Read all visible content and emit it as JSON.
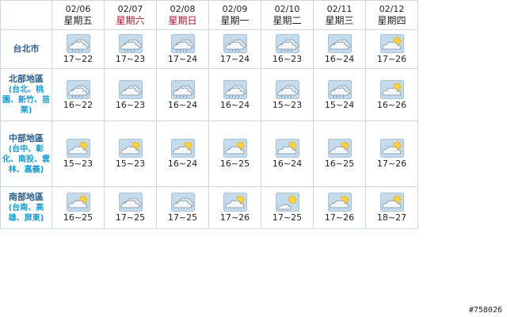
{
  "days": [
    {
      "date": "02/06",
      "weekday": "星期五",
      "weekend": false
    },
    {
      "date": "02/07",
      "weekday": "星期六",
      "weekend": true
    },
    {
      "date": "02/08",
      "weekday": "星期日",
      "weekend": true
    },
    {
      "date": "02/09",
      "weekday": "星期一",
      "weekend": false
    },
    {
      "date": "02/10",
      "weekday": "星期二",
      "weekend": false
    },
    {
      "date": "02/11",
      "weekday": "星期三",
      "weekend": false
    },
    {
      "date": "02/12",
      "weekday": "星期四",
      "weekend": false
    }
  ],
  "regions": [
    {
      "name": "台北市",
      "sub": "",
      "cells": [
        {
          "icon": "rain-icon",
          "temp": "17~22"
        },
        {
          "icon": "rain-icon",
          "temp": "17~23"
        },
        {
          "icon": "rain-icon",
          "temp": "17~24"
        },
        {
          "icon": "rain-icon",
          "temp": "17~24"
        },
        {
          "icon": "rain-icon",
          "temp": "16~23"
        },
        {
          "icon": "cloudy-icon",
          "temp": "16~24"
        },
        {
          "icon": "partly-cloudy-icon",
          "temp": "17~26"
        }
      ]
    },
    {
      "name": "北部地區",
      "sub": "(台北、桃園、新竹、苗栗)",
      "cells": [
        {
          "icon": "rain-icon",
          "temp": "16~22"
        },
        {
          "icon": "cloudy-icon",
          "temp": "16~23"
        },
        {
          "icon": "rain-icon",
          "temp": "16~24"
        },
        {
          "icon": "rain-icon",
          "temp": "16~24"
        },
        {
          "icon": "rain-icon",
          "temp": "15~23"
        },
        {
          "icon": "rain-icon",
          "temp": "15~24"
        },
        {
          "icon": "partly-cloudy-icon",
          "temp": "16~26"
        }
      ]
    },
    {
      "name": "中部地區",
      "sub": "(台中、彰化、南投、雲林、嘉義)",
      "cells": [
        {
          "icon": "partly-cloudy-icon",
          "temp": "15~23"
        },
        {
          "icon": "partly-cloudy-icon",
          "temp": "15~23"
        },
        {
          "icon": "partly-cloudy-icon",
          "temp": "16~24"
        },
        {
          "icon": "partly-cloudy-icon",
          "temp": "16~25"
        },
        {
          "icon": "partly-cloudy-icon",
          "temp": "16~24"
        },
        {
          "icon": "partly-cloudy-icon",
          "temp": "16~25"
        },
        {
          "icon": "partly-cloudy-icon",
          "temp": "17~26"
        }
      ]
    },
    {
      "name": "南部地區",
      "sub": "(台南、高雄、屏東)",
      "cells": [
        {
          "icon": "partly-cloudy-icon",
          "temp": "16~25"
        },
        {
          "icon": "cloudy-icon",
          "temp": "17~25"
        },
        {
          "icon": "cloudy-icon",
          "temp": "17~25"
        },
        {
          "icon": "partly-cloudy-icon",
          "temp": "17~26"
        },
        {
          "icon": "sunny-cloud-icon",
          "temp": "17~25"
        },
        {
          "icon": "partly-cloudy-icon",
          "temp": "17~26"
        },
        {
          "icon": "partly-cloudy-icon",
          "temp": "18~27"
        }
      ]
    }
  ],
  "watermark": "#758026",
  "colors": {
    "weekend": "#b5102f",
    "region": "#2a5d8a",
    "region_sub": "#1a9bd0",
    "grid": "#c9d6e3"
  }
}
